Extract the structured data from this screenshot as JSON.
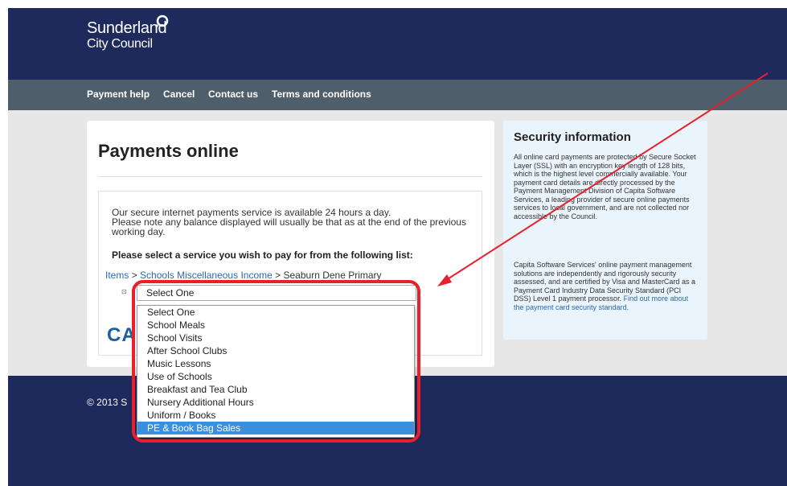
{
  "header": {
    "logo_line1": "Sunderland",
    "logo_line2": "City Council"
  },
  "nav": {
    "items": [
      "Payment help",
      "Cancel",
      "Contact us",
      "Terms and conditions"
    ]
  },
  "main": {
    "title": "Payments online",
    "intro_line1": "Our secure internet payments service is available 24 hours a day.",
    "intro_line2": "Please note any balance displayed will usually be that as at the end of the previous working day.",
    "instruction": "Please select a service you wish to pay for from the following list:",
    "breadcrumb": {
      "items_link": "Items",
      "separator": ">",
      "category_link": "Schools Miscellaneous Income",
      "current": "Seaburn Dene Primary"
    },
    "select_value": "Select One",
    "brand_partial": "CA"
  },
  "dropdown": {
    "options": [
      "Select One",
      "School Meals",
      "School Visits",
      "After School Clubs",
      "Music Lessons",
      "Use of Schools",
      "Breakfast and Tea Club",
      "Nursery Additional Hours",
      "Uniform / Books",
      "PE & Book Bag Sales"
    ],
    "highlighted": "PE & Book Bag Sales"
  },
  "security": {
    "title": "Security information",
    "para1": "All online card payments are protected by Secure Socket Layer (SSL) with an encryption key length of 128 bits, which is the highest level commercially available. Your payment card details are directly processed by the Payment Management Division of Capita Software Services, a leading provider of secure online payments services to local government, and are not collected nor accessible by the Council.",
    "para2": "Capita Software Services' online payment management solutions are independently and rigorously security assessed, and are certified by Visa and MasterCard as a Payment Card Industry Data Security Standard (PCI DSS) Level 1 payment processor.",
    "para2_link": "Find out more about the payment card security standard."
  },
  "footer": {
    "copyright_partial": "© 2013 S"
  },
  "colors": {
    "header_bg": "#1f2a5c",
    "nav_bg": "#4f5e6b",
    "link": "#2a6ab3",
    "highlight_annotation": "#e8202a",
    "selected_option": "#3b8fe0"
  }
}
